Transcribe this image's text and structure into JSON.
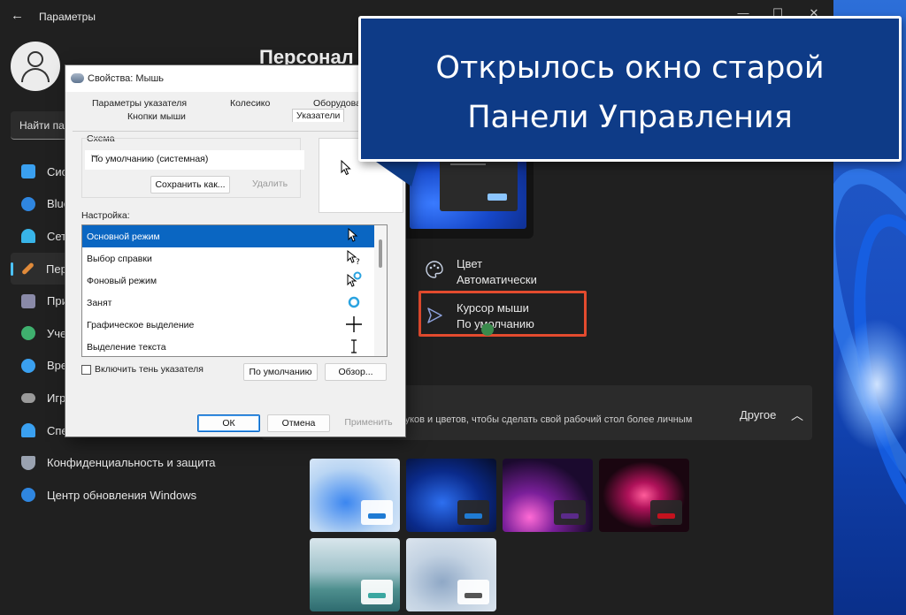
{
  "window": {
    "title": "Параметры",
    "back_icon": "arrow-left-icon",
    "controls": {
      "minimize": "—",
      "maximize": "☐",
      "close": "✕"
    }
  },
  "search": {
    "placeholder": "Найти па"
  },
  "sidebar": {
    "items": [
      {
        "label": "Сис",
        "icon": "display-icon",
        "color": "#3aa0f0"
      },
      {
        "label": "Blue",
        "icon": "bluetooth-icon",
        "color": "#2f86e0"
      },
      {
        "label": "Сет",
        "icon": "wifi-icon",
        "color": "#38b4e8"
      },
      {
        "label": "Пер",
        "icon": "brush-icon",
        "color": "#e08a3a",
        "active": true
      },
      {
        "label": "При",
        "icon": "apps-icon",
        "color": "#8a8aa8"
      },
      {
        "label": "Уче",
        "icon": "person-icon",
        "color": "#3fb06e"
      },
      {
        "label": "Вре",
        "icon": "globe-icon",
        "color": "#3aa0f0"
      },
      {
        "label": "Игр",
        "icon": "gamepad-icon",
        "color": "#9a9a9a"
      },
      {
        "label": "Спе",
        "icon": "accessibility-icon",
        "color": "#3aa0f0"
      },
      {
        "label": "Конфиденциальность и защита",
        "icon": "shield-icon",
        "color": "#9aa2b0"
      },
      {
        "label": "Центр обновления Windows",
        "icon": "update-icon",
        "color": "#2f86e0"
      }
    ]
  },
  "main": {
    "page_title": "Персонал",
    "options": [
      {
        "title": "Цвет",
        "subtitle": "Автоматически",
        "icon": "palette-icon"
      },
      {
        "title": "Курсор мыши",
        "subtitle": "По умолчанию",
        "icon": "cursor-icon"
      }
    ],
    "themes_section": {
      "description": "вуков и цветов, чтобы сделать свой рабочий стол более личным",
      "toggle_label": "Другое"
    },
    "themes": [
      {
        "name": "windows-light",
        "accent": "#1f7bd4"
      },
      {
        "name": "windows-dark",
        "accent": "#1f7bd4"
      },
      {
        "name": "glow",
        "accent": "#5b2a8a"
      },
      {
        "name": "captured-motion",
        "accent": "#c4121e"
      },
      {
        "name": "sunrise",
        "accent": "#3aa7a0"
      },
      {
        "name": "flow",
        "accent": "#555555"
      }
    ]
  },
  "dialog": {
    "title": "Свойства: Мышь",
    "tabs": [
      "Параметры указателя",
      "Колесико",
      "Оборудова",
      "Кнопки мыши",
      "Указатели"
    ],
    "scheme_label": "Схема",
    "scheme_value": "По умолчанию (системная)",
    "save_as": "Сохранить как...",
    "delete": "Удалить",
    "customize_label": "Настройка:",
    "cursors": [
      "Основной режим",
      "Выбор справки",
      "Фоновый режим",
      "Занят",
      "Графическое выделение",
      "Выделение текста"
    ],
    "shadow_label": "Включить тень указателя",
    "use_default": "По умолчанию",
    "browse": "Обзор...",
    "ok": "ОК",
    "cancel": "Отмена",
    "apply": "Применить"
  },
  "callout": {
    "line1": "Открылось окно старой",
    "line2": "Панели Управления"
  }
}
